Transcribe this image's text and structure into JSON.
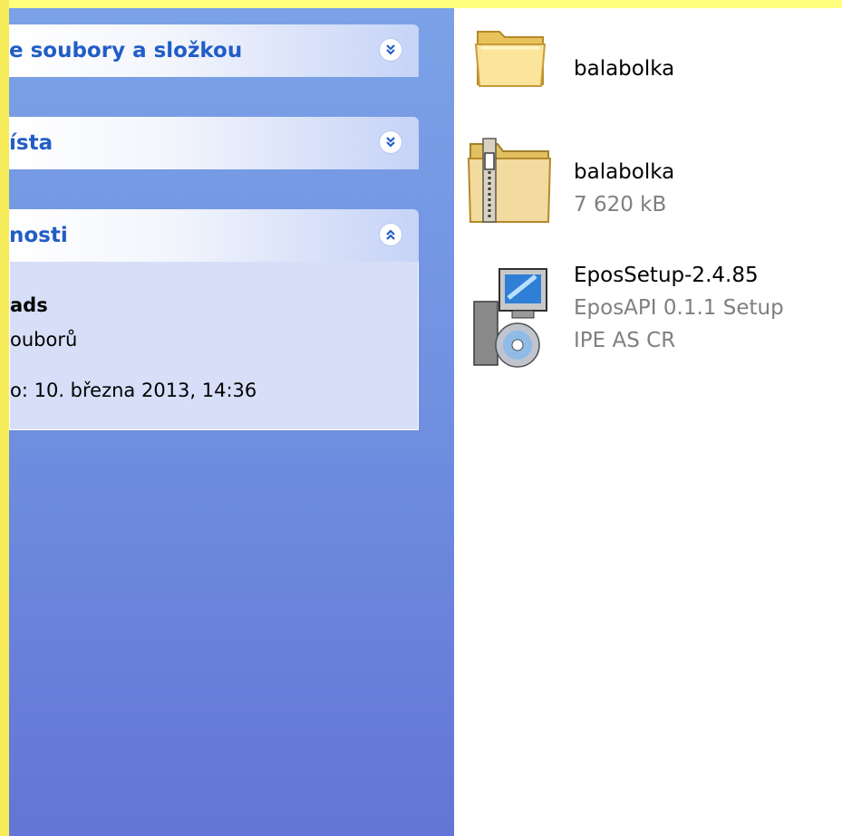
{
  "sidebar": {
    "panels": [
      {
        "title": "e soubory a složkou",
        "chevron": "chevron-down-double-icon"
      },
      {
        "title": "ísta",
        "chevron": "chevron-down-double-icon"
      },
      {
        "title": "nosti",
        "chevron": "chevron-up-double-icon"
      }
    ],
    "details": {
      "name": "ads",
      "type": "ouborů",
      "modified": "o: 10. března 2013, 14:36"
    }
  },
  "files": [
    {
      "name": "balabolka",
      "line2": "",
      "line3": "",
      "icon": "folder-icon"
    },
    {
      "name": "balabolka",
      "line2": "7 620 kB",
      "line3": "",
      "icon": "zip-folder-icon"
    },
    {
      "name": "EposSetup-2.4.85",
      "line2": "EposAPI 0.1.1 Setup",
      "line3": "IPE AS CR",
      "icon": "setup-installer-icon"
    }
  ]
}
